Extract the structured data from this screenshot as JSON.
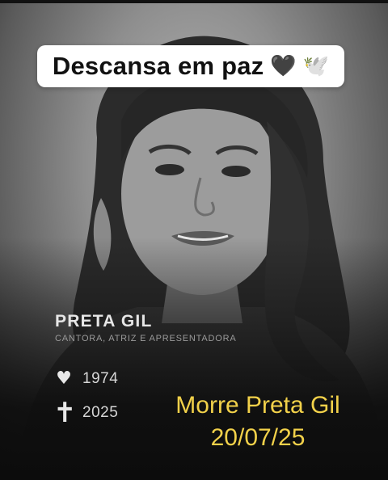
{
  "caption": {
    "text": "Descansa em paz",
    "emoji_heart": "🖤",
    "emoji_dove": "🕊️",
    "icons": [
      "black-heart-icon",
      "dove-icon"
    ]
  },
  "card": {
    "name": "PRETA GIL",
    "subtitle": "CANTORA, ATRIZ E APRESENTADORA",
    "birth_icon": "♥",
    "birth_year": "1974",
    "death_icon": "✝",
    "death_year": "2025"
  },
  "headline": {
    "line1": "Morre Preta Gil",
    "line2": "20/07/25",
    "color": "#f2d14a"
  },
  "theme": {
    "background": "#0c0c0c",
    "pill": "#ffffff"
  }
}
